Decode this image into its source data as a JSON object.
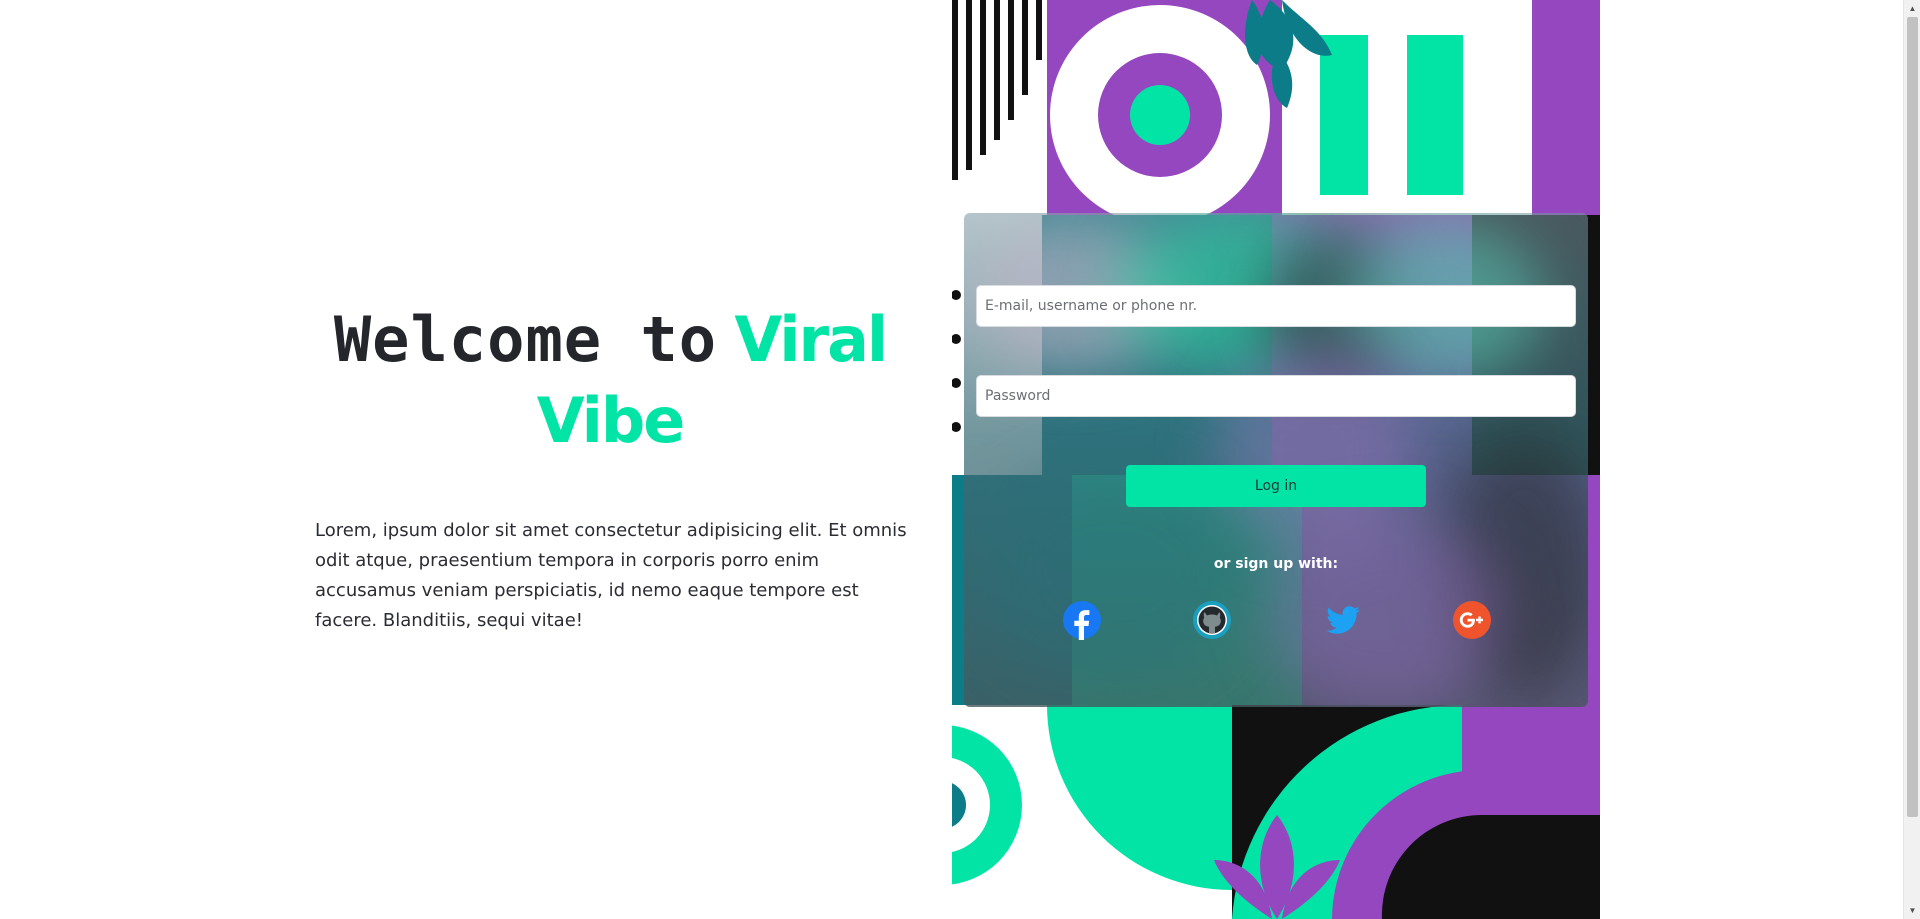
{
  "hero": {
    "title_part1": "Welcome to",
    "title_part2": "Viral",
    "title_part3": "Vibe",
    "description": "Lorem, ipsum dolor sit amet consectetur adipisicing elit. Et omnis odit atque, praesentium tempora in corporis porro enim accusamus veniam perspiciatis, id nemo eaque tempore est facere. Blanditiis, sequi vitae!"
  },
  "login": {
    "identity_placeholder": "E-mail, username or phone nr.",
    "identity_value": "",
    "password_placeholder": "Password",
    "password_value": "",
    "login_label": "Log in",
    "signup_label": "or sign up with:",
    "socials": [
      {
        "icon": "facebook-icon",
        "color": "#1877f2"
      },
      {
        "icon": "github-icon",
        "color": "#1a9fc0"
      },
      {
        "icon": "twitter-icon",
        "color": "#1da1f2"
      },
      {
        "icon": "google-plus-icon",
        "color": "#f0542d"
      }
    ]
  },
  "colors": {
    "accent": "#02e4a6",
    "purple": "#9547bf",
    "teal": "#0b7c88",
    "dark": "#24262c"
  }
}
